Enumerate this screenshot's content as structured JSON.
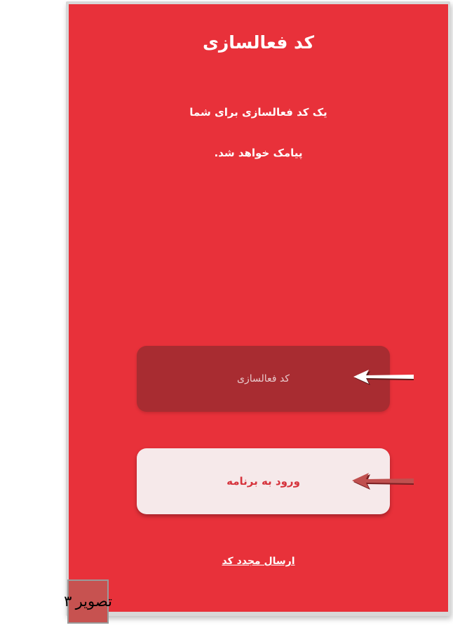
{
  "screen": {
    "title": "کد فعالسازی",
    "subtitle_line1": "یک کد فعالسازی برای شما",
    "subtitle_line2": "پیامک خواهد شد.",
    "code_field_placeholder": "کد فعالسازی",
    "login_button_label": "ورود به برنامه",
    "resend_link_label": "ارسال مجدد کد"
  },
  "caption": {
    "label": "تصویر ۳"
  },
  "colors": {
    "screen_background": "#e8313a",
    "code_field_background": "#a82c31",
    "login_button_background": "#f6e9ea",
    "login_button_text": "#d6343d",
    "caption_background": "#c75250"
  },
  "icons": {
    "annotation_arrow_1": "left-arrow-icon",
    "annotation_arrow_2": "left-arrow-icon"
  }
}
